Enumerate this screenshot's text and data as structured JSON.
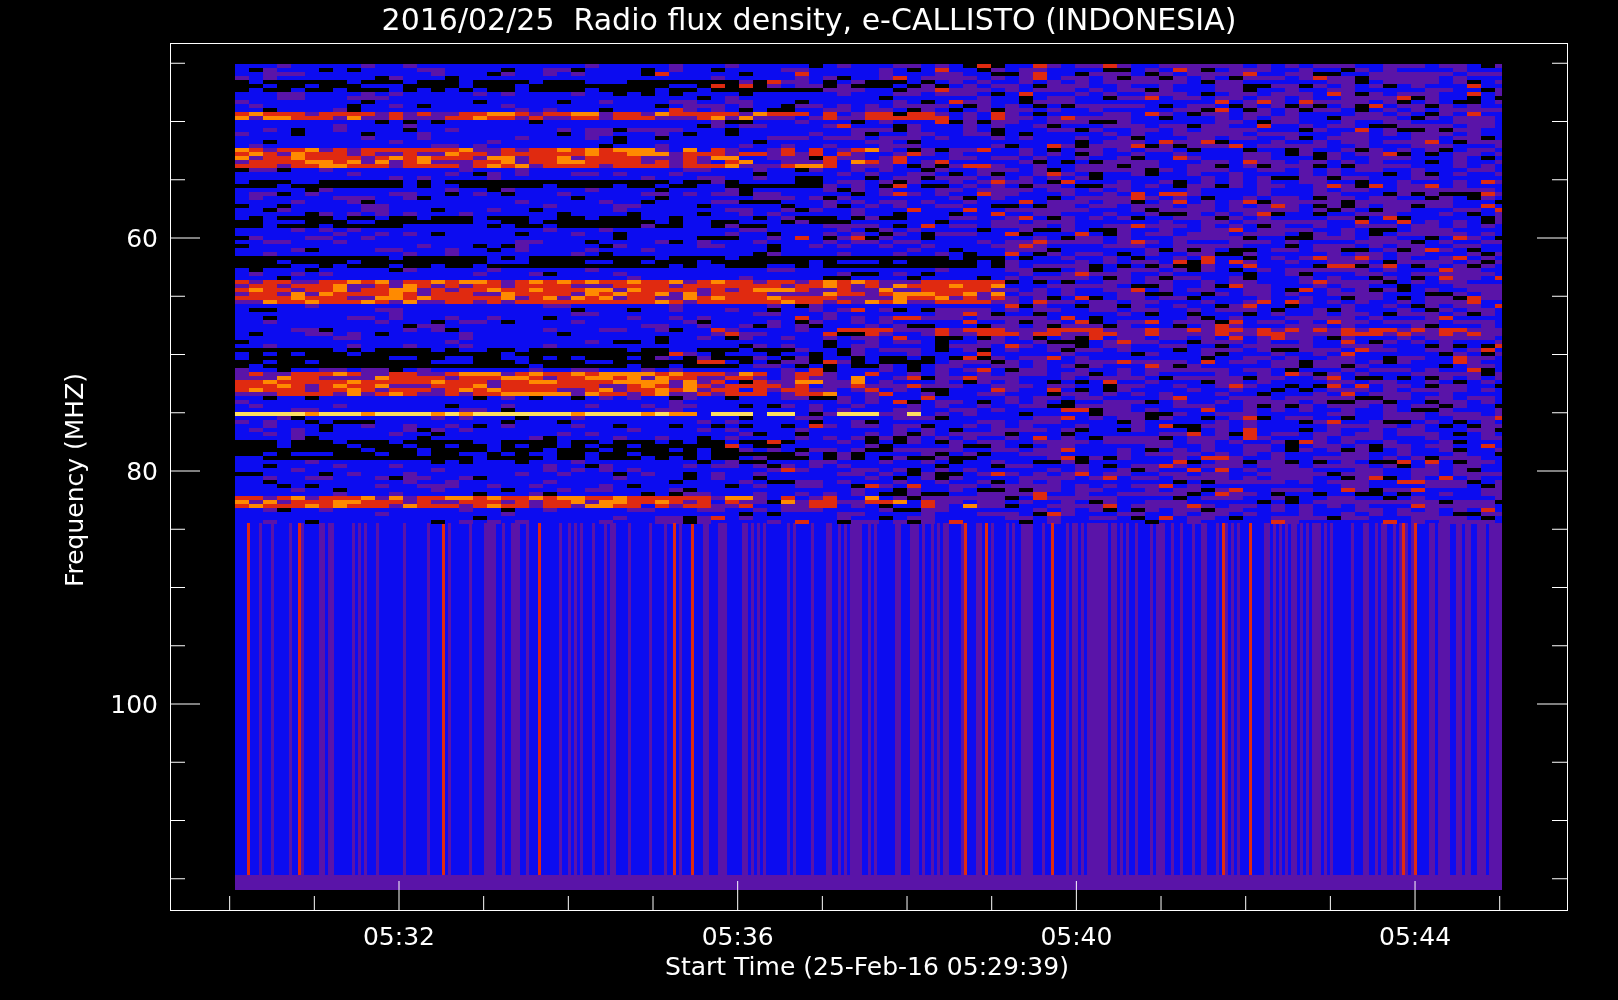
{
  "title": "2016/02/25  Radio flux density, e-CALLISTO (INDONESIA)",
  "y_axis": {
    "label": "Frequency (MHZ)",
    "ticks": [
      "60",
      "80",
      "100"
    ]
  },
  "x_axis": {
    "label": "Start Time (25-Feb-16 05:29:39)",
    "ticks": [
      "05:32",
      "05:36",
      "05:40",
      "05:44"
    ]
  }
}
